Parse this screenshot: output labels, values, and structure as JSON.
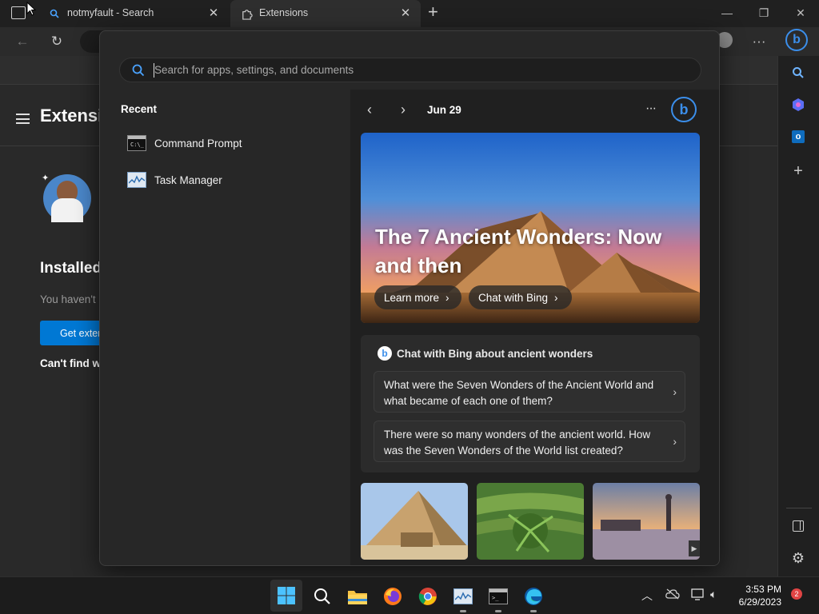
{
  "browser": {
    "tabs": [
      {
        "label": "notmyfault - Search",
        "icon": "search-icon"
      },
      {
        "label": "Extensions",
        "icon": "puzzle-icon"
      }
    ],
    "new_tab": "+"
  },
  "page_behind": {
    "heading": "Extensi",
    "installed_heading": "Installed",
    "empty_text": "You haven't",
    "get_button": "Get exten",
    "cant_find": "Can't find wi"
  },
  "start_menu": {
    "search_placeholder": "Search for apps, settings, and documents",
    "recent_title": "Recent",
    "recent_items": [
      {
        "label": "Command Prompt",
        "icon": "command-prompt-icon"
      },
      {
        "label": "Task Manager",
        "icon": "task-manager-icon"
      }
    ],
    "date": "Jun 29",
    "more": "···",
    "hero": {
      "title": "The 7 Ancient Wonders: Now and then",
      "learn_more": "Learn more",
      "chat_with_bing": "Chat with Bing"
    },
    "chat_card": {
      "title": "Chat with Bing about ancient wonders",
      "questions": [
        "What were the Seven Wonders of the Ancient World and what became of each one of them?",
        "There were so many wonders of the ancient world. How was the Seven Wonders of the World list created?"
      ]
    }
  },
  "taskbar": {
    "time": "3:53 PM",
    "date": "6/29/2023",
    "notifications": "2"
  },
  "colors": {
    "accent": "#0078d4",
    "menu_bg": "#272727",
    "taskbar_bg": "#1c1c1c",
    "badge": "#e04444"
  }
}
